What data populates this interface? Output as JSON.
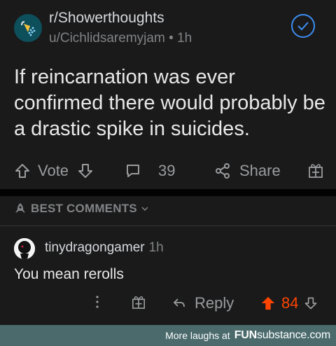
{
  "post": {
    "subreddit": "r/Showerthoughts",
    "author": "u/Cichlidsaremyjam",
    "age": "1h",
    "title": "If reincarnation was ever confirmed there would probably be a drastic spike in suicides.",
    "vote_label": "Vote",
    "comment_count": "39",
    "share_label": "Share"
  },
  "comments_header": {
    "label": "BEST COMMENTS"
  },
  "comment": {
    "username": "tinydragongamer",
    "age": "1h",
    "body": "You mean rerolls",
    "reply_label": "Reply",
    "score": "84"
  },
  "footer": {
    "text": "More laughs at",
    "brand_bold": "FUN",
    "brand_rest": "substance.com"
  },
  "colors": {
    "background": "#1a1a1b",
    "upvote_active": "#ff4500",
    "verified_blue": "#3d8ef0",
    "footer_bar": "#4a6a6c"
  },
  "icons": [
    "shower-icon",
    "checkmark-icon",
    "upvote-icon",
    "downvote-icon",
    "comment-icon",
    "share-icon",
    "gift-icon",
    "rocket-icon",
    "chevron-down-icon",
    "more-icon",
    "reply-icon"
  ]
}
